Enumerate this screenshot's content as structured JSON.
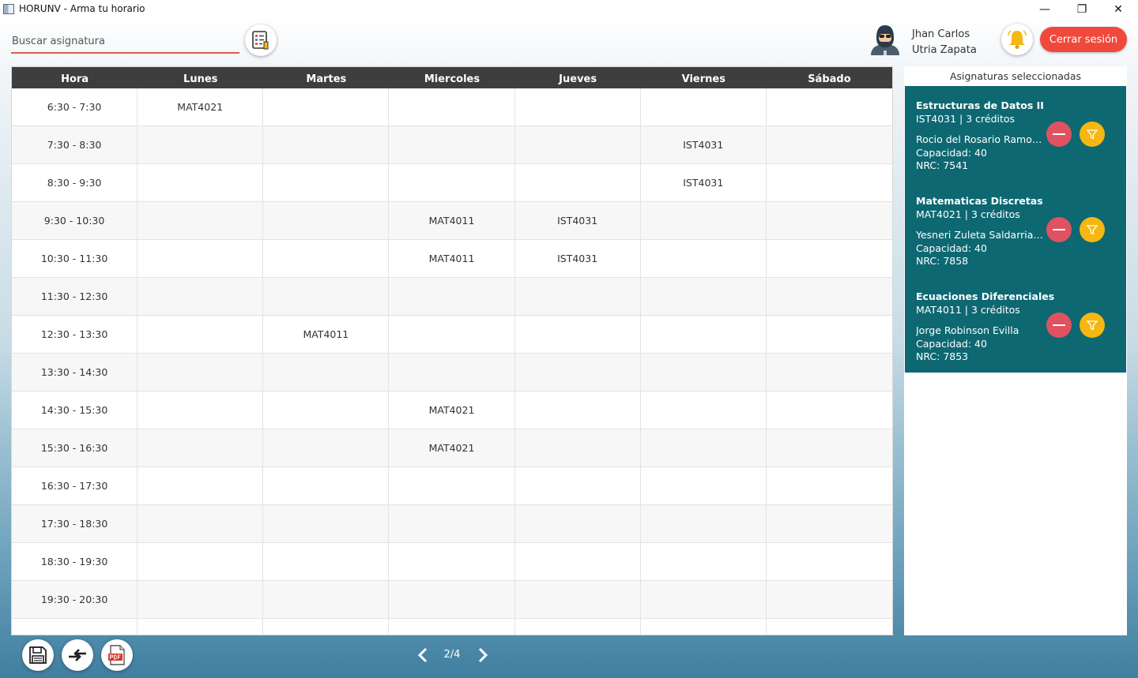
{
  "window": {
    "title": "HORUNV - Arma tu horario",
    "minimize": "—",
    "maximize": "❐",
    "close": "✕"
  },
  "search": {
    "placeholder": "Buscar asignatura"
  },
  "user": {
    "first_line": "Jhan Carlos",
    "second_line": "Utria Zapata",
    "logout_label": "Cerrar sesión"
  },
  "schedule": {
    "headers": [
      "Hora",
      "Lunes",
      "Martes",
      "Miercoles",
      "Jueves",
      "Viernes",
      "Sábado"
    ],
    "rows": [
      [
        "6:30 - 7:30",
        "MAT4021",
        "",
        "",
        "",
        "",
        ""
      ],
      [
        "7:30 - 8:30",
        "",
        "",
        "",
        "",
        "IST4031",
        ""
      ],
      [
        "8:30 - 9:30",
        "",
        "",
        "",
        "",
        "IST4031",
        ""
      ],
      [
        "9:30 - 10:30",
        "",
        "",
        "MAT4011",
        "IST4031",
        "",
        ""
      ],
      [
        "10:30 - 11:30",
        "",
        "",
        "MAT4011",
        "IST4031",
        "",
        ""
      ],
      [
        "11:30 - 12:30",
        "",
        "",
        "",
        "",
        "",
        ""
      ],
      [
        "12:30 - 13:30",
        "",
        "MAT4011",
        "",
        "",
        "",
        ""
      ],
      [
        "13:30 - 14:30",
        "",
        "",
        "",
        "",
        "",
        ""
      ],
      [
        "14:30 - 15:30",
        "",
        "",
        "MAT4021",
        "",
        "",
        ""
      ],
      [
        "15:30 - 16:30",
        "",
        "",
        "MAT4021",
        "",
        "",
        ""
      ],
      [
        "16:30 - 17:30",
        "",
        "",
        "",
        "",
        "",
        ""
      ],
      [
        "17:30 - 18:30",
        "",
        "",
        "",
        "",
        "",
        ""
      ],
      [
        "18:30 - 19:30",
        "",
        "",
        "",
        "",
        "",
        ""
      ],
      [
        "19:30 - 20:30",
        "",
        "",
        "",
        "",
        "",
        ""
      ],
      [
        "",
        "",
        "",
        "",
        "",
        "",
        ""
      ]
    ]
  },
  "selected": {
    "title": "Asignaturas seleccionadas",
    "courses": [
      {
        "name": "Estructuras de Datos II",
        "code_credits": "IST4031 | 3 créditos",
        "teacher": "Rocio del Rosario Ramos Pacheco",
        "capacity": "Capacidad: 40",
        "nrc": "NRC: 7541"
      },
      {
        "name": "Matematicas Discretas",
        "code_credits": "MAT4021 | 3 créditos",
        "teacher": "Yesneri Zuleta Saldarriaga",
        "capacity": "Capacidad: 40",
        "nrc": "NRC: 7858"
      },
      {
        "name": "Ecuaciones Diferenciales",
        "code_credits": "MAT4011 | 3 créditos",
        "teacher": "Jorge Robinson Evilla",
        "capacity": "Capacidad: 40",
        "nrc": "NRC: 7853"
      }
    ]
  },
  "pager": {
    "text": "2/4"
  },
  "colors": {
    "accent_red": "#f0493c",
    "panel_teal": "#0d6872",
    "remove_red": "#e05260",
    "filter_yellow": "#f5b711",
    "header_dark": "#3e3e3e"
  },
  "icons": [
    "app-icon",
    "subject-list-icon",
    "user-avatar-icon",
    "bell-icon",
    "remove-icon",
    "filter-icon",
    "save-icon",
    "swap-icon",
    "pdf-icon",
    "chevron-left-icon",
    "chevron-right-icon"
  ]
}
